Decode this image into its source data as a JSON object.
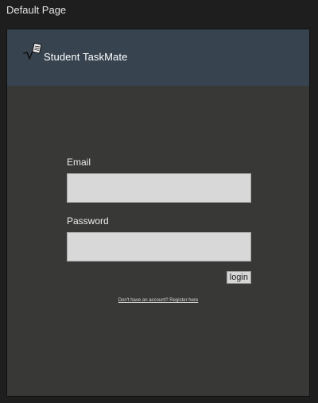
{
  "window": {
    "title": "Default Page"
  },
  "header": {
    "logo_icon": "checkmark-clipboard-icon",
    "app_name": "Student TaskMate",
    "background_color": "#374450"
  },
  "login_form": {
    "email_label": "Email",
    "email_value": "",
    "password_label": "Password",
    "password_value": "",
    "login_label": "login"
  },
  "register": {
    "link_text": "Don't have an account? Register here"
  },
  "colors": {
    "page_background": "#383936",
    "input_background": "#d8d8d8"
  }
}
